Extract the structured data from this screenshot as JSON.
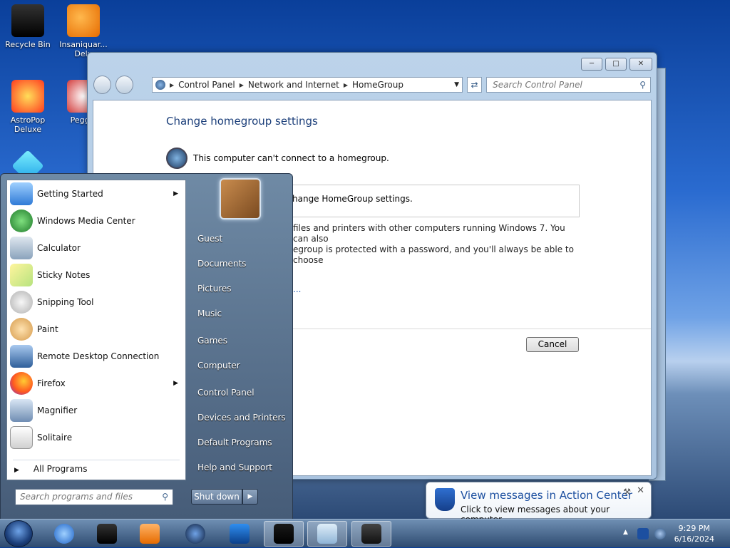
{
  "desktop": {
    "icons": [
      {
        "label": "Recycle Bin",
        "icon": "recycle-bin-icon"
      },
      {
        "label": "Insaniquar... Delu",
        "icon": "fish-icon"
      },
      {
        "label": "AstroPop Deluxe",
        "icon": "astropop-icon"
      },
      {
        "label": "Peggle",
        "icon": "peggle-icon"
      },
      {
        "label": "",
        "icon": "gem-icon"
      }
    ]
  },
  "explorer": {
    "breadcrumb": [
      "Control Panel",
      "Network and Internet",
      "HomeGroup"
    ],
    "search_placeholder": "Search Control Panel",
    "heading": "Change homegroup settings",
    "status": "This computer can't connect to a homegroup.",
    "box_text": "hange HomeGroup settings.",
    "desc_line1": "files and printers with other computers running Windows 7. You can also",
    "desc_line2": "egroup is protected with a password, and you'll always be able to choose",
    "link": "...",
    "cancel": "Cancel"
  },
  "start_menu": {
    "programs": [
      {
        "label": "Getting Started",
        "icon": "getting-started-icon",
        "arrow": "▶"
      },
      {
        "label": "Windows Media Center",
        "icon": "media-center-icon"
      },
      {
        "label": "Calculator",
        "icon": "calculator-icon"
      },
      {
        "label": "Sticky Notes",
        "icon": "sticky-notes-icon"
      },
      {
        "label": "Snipping Tool",
        "icon": "snipping-tool-icon"
      },
      {
        "label": "Paint",
        "icon": "paint-icon"
      },
      {
        "label": "Remote Desktop Connection",
        "icon": "remote-desktop-icon"
      },
      {
        "label": "Firefox",
        "icon": "firefox-icon",
        "arrow": "▶"
      },
      {
        "label": "Magnifier",
        "icon": "magnifier-icon"
      },
      {
        "label": "Solitaire",
        "icon": "solitaire-icon"
      }
    ],
    "all_programs": "All Programs",
    "search_placeholder": "Search programs and files",
    "right_items": [
      "Guest",
      "Documents",
      "Pictures",
      "Music",
      "Games",
      "Computer",
      "Control Panel",
      "Devices and Printers",
      "Default Programs",
      "Help and Support"
    ],
    "shutdown": "Shut down"
  },
  "notification": {
    "title": "View messages in Action Center",
    "subtitle": "Click to view messages about your computer."
  },
  "taskbar": {
    "time": "9:29 PM",
    "date": "6/16/2024"
  }
}
